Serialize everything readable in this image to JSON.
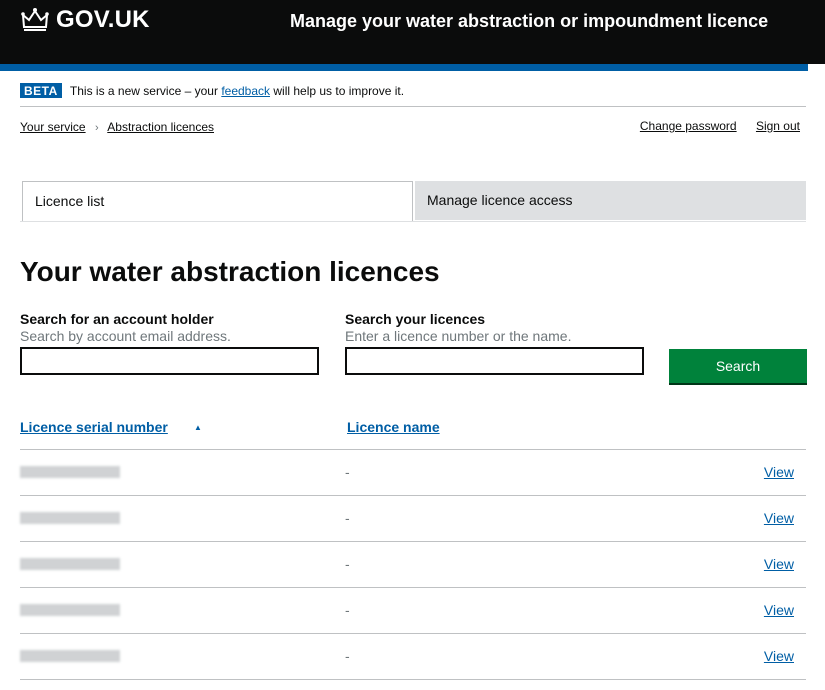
{
  "header": {
    "logo_text": "GOV.UK",
    "service_name": "Manage your water abstraction or impoundment licence",
    "bg_color": "#0b0c0c",
    "accent_color": "#005ea5"
  },
  "phase_banner": {
    "tag": "BETA",
    "text_before": "This is a new service – your",
    "link": "feedback",
    "text_after": "will help us to improve it."
  },
  "breadcrumbs": [
    {
      "label": "Your service"
    },
    {
      "label": "Abstraction licences"
    }
  ],
  "account_links": {
    "change_password": "Change password",
    "sign_out": "Sign out"
  },
  "tabs": [
    {
      "label": "Licence list",
      "active": true
    },
    {
      "label": "Manage licence access",
      "active": false
    }
  ],
  "page_title": "Your water abstraction licences",
  "search": {
    "account_holder": {
      "label": "Search for an account holder",
      "hint": "Search by account email address.",
      "value": ""
    },
    "licences": {
      "label": "Search your licences",
      "hint": "Enter a licence number or the name.",
      "value": ""
    },
    "button_label": "Search",
    "button_color": "#00823b"
  },
  "table": {
    "columns": [
      {
        "label": "Licence serial number",
        "sort_icon": "sort-ascending-icon"
      },
      {
        "label": "Licence name"
      }
    ],
    "rows": [
      {
        "name": "-",
        "action": "View"
      },
      {
        "name": "-",
        "action": "View"
      },
      {
        "name": "-",
        "action": "View"
      },
      {
        "name": "-",
        "action": "View"
      },
      {
        "name": "-",
        "action": "View"
      }
    ]
  }
}
